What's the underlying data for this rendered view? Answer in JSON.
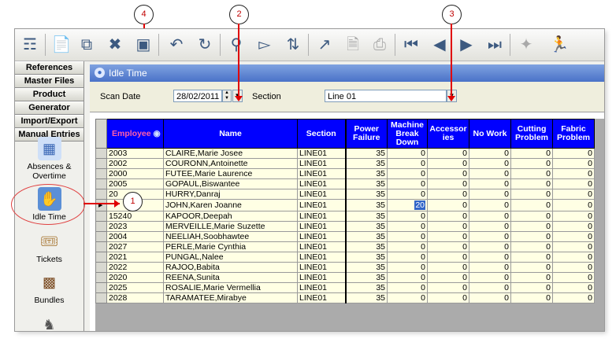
{
  "sidebar": {
    "menus": [
      "References",
      "Master Files",
      "Product",
      "Generator",
      "Import/Export",
      "Manual Entries"
    ],
    "items": [
      {
        "label": "Absences &\nOvertime",
        "icon": "calendar-icon"
      },
      {
        "label": "Idle Time",
        "icon": "hand-icon"
      },
      {
        "label": "Tickets",
        "icon": "tickets-icon"
      },
      {
        "label": "Bundles",
        "icon": "bundles-icon"
      }
    ]
  },
  "window": {
    "title": "Idle Time"
  },
  "filter": {
    "scan_date_label": "Scan Date",
    "scan_date_value": "28/02/2011",
    "section_label": "Section",
    "section_value": "Line 01"
  },
  "grid": {
    "columns": [
      "Employee",
      "Name",
      "Section",
      "Power\nFailure",
      "Machine\nBreak\nDown",
      "Accessor\nies",
      "No Work",
      "Cutting\nProblem",
      "Fabric\nProblem"
    ],
    "rows": [
      [
        "2003",
        "CLAIRE,Marie Josee",
        "LINE01",
        "35",
        "0",
        "0",
        "0",
        "0",
        "0"
      ],
      [
        "2002",
        "COURONN,Antoinette",
        "LINE01",
        "35",
        "0",
        "0",
        "0",
        "0",
        "0"
      ],
      [
        "2000",
        "FUTEE,Marie Laurence",
        "LINE01",
        "35",
        "0",
        "0",
        "0",
        "0",
        "0"
      ],
      [
        "2005",
        "GOPAUL,Biswantee",
        "LINE01",
        "35",
        "0",
        "0",
        "0",
        "0",
        "0"
      ],
      [
        "20",
        "HURRY,Danraj",
        "LINE01",
        "35",
        "0",
        "0",
        "0",
        "0",
        "0"
      ],
      [
        "",
        "JOHN,Karen Joanne",
        "LINE01",
        "35",
        "20",
        "0",
        "0",
        "0",
        "0"
      ],
      [
        "15240",
        "KAPOOR,Deepah",
        "LINE01",
        "35",
        "0",
        "0",
        "0",
        "0",
        "0"
      ],
      [
        "2023",
        "MERVEILLE,Marie Suzette",
        "LINE01",
        "35",
        "0",
        "0",
        "0",
        "0",
        "0"
      ],
      [
        "2004",
        "NEELIAH,Soobhawtee",
        "LINE01",
        "35",
        "0",
        "0",
        "0",
        "0",
        "0"
      ],
      [
        "2027",
        "PERLE,Marie Cynthia",
        "LINE01",
        "35",
        "0",
        "0",
        "0",
        "0",
        "0"
      ],
      [
        "2021",
        "PUNGAL,Nalee",
        "LINE01",
        "35",
        "0",
        "0",
        "0",
        "0",
        "0"
      ],
      [
        "2022",
        "RAJOO,Babita",
        "LINE01",
        "35",
        "0",
        "0",
        "0",
        "0",
        "0"
      ],
      [
        "2020",
        "REENA,Sunita",
        "LINE01",
        "35",
        "0",
        "0",
        "0",
        "0",
        "0"
      ],
      [
        "2025",
        "ROSALIE,Marie Vermellia",
        "LINE01",
        "35",
        "0",
        "0",
        "0",
        "0",
        "0"
      ],
      [
        "2028",
        "TARAMATEE,Mirabye",
        "LINE01",
        "35",
        "0",
        "0",
        "0",
        "0",
        "0"
      ]
    ]
  },
  "callouts": [
    "1",
    "2",
    "3",
    "4"
  ],
  "colors": {
    "header_bg": "#0000ff",
    "row_bg": "#ffffe4",
    "title_bg": "#4a72c8",
    "callout_red": "#e00000"
  }
}
